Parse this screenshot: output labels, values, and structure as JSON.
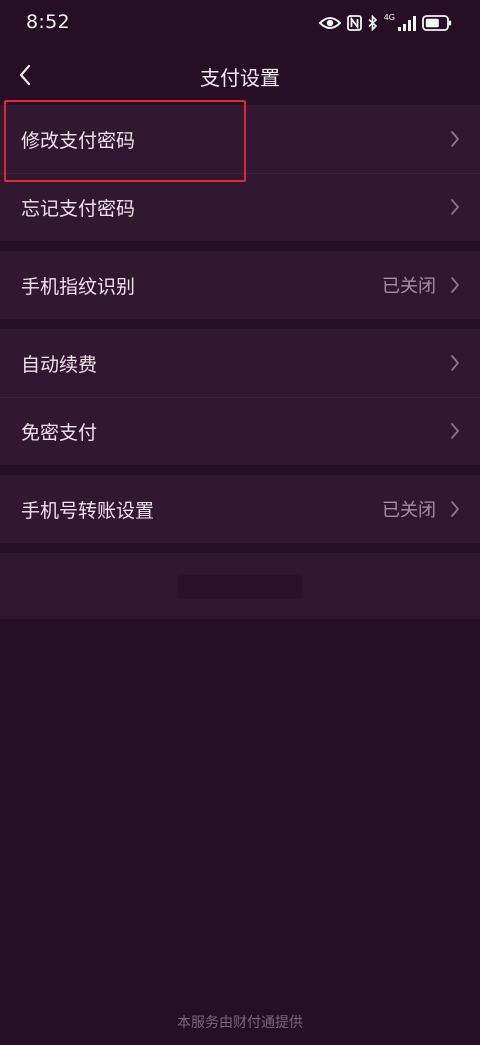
{
  "status_bar": {
    "time": "8:52",
    "network_label": "4G",
    "icons": [
      "eye-icon",
      "nfc-icon",
      "bluetooth-icon",
      "signal-icon",
      "battery-icon"
    ]
  },
  "nav": {
    "title": "支付设置",
    "back_icon": "chevron-left-icon"
  },
  "groups": [
    {
      "items": [
        {
          "label": "修改支付密码",
          "value": ""
        },
        {
          "label": "忘记支付密码",
          "value": ""
        }
      ]
    },
    {
      "items": [
        {
          "label": "手机指纹识别",
          "value": "已关闭"
        }
      ]
    },
    {
      "items": [
        {
          "label": "自动续费",
          "value": ""
        },
        {
          "label": "免密支付",
          "value": ""
        }
      ]
    },
    {
      "items": [
        {
          "label": "手机号转账设置",
          "value": "已关闭"
        }
      ]
    }
  ],
  "footer": {
    "note": "本服务由财付通提供"
  },
  "colors": {
    "background": "#260e26",
    "panel": "#321731",
    "highlight": "#e0283a",
    "muted_text": "#a88ea3"
  }
}
